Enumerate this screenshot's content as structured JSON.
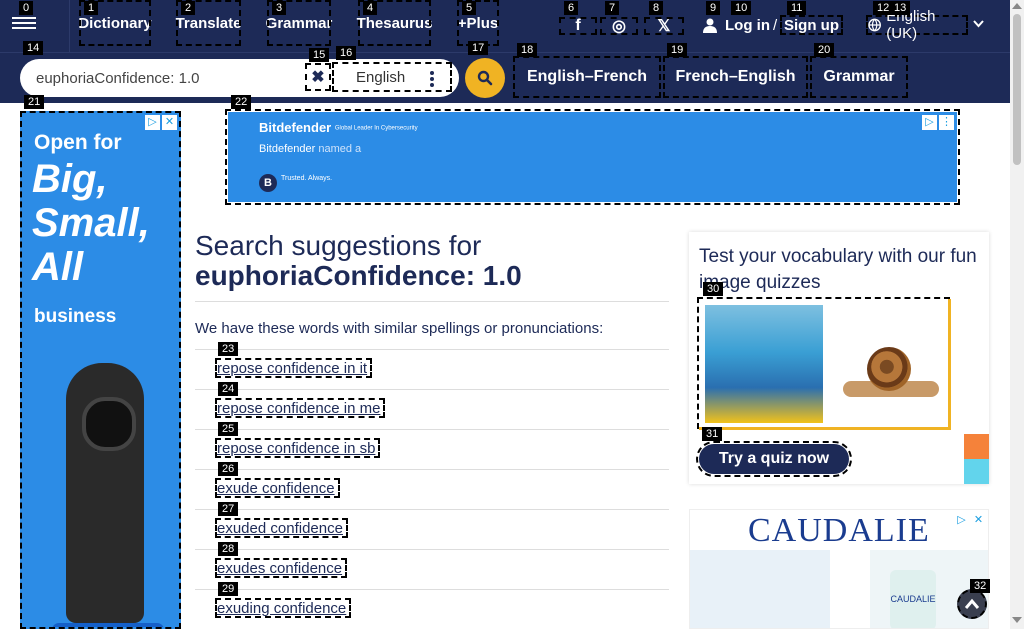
{
  "header": {
    "nav": [
      {
        "label": "Dictionary",
        "tag": "1"
      },
      {
        "label": "Translate",
        "tag": "2"
      },
      {
        "label": "Grammar",
        "tag": "3"
      },
      {
        "label": "Thesaurus",
        "tag": "4"
      },
      {
        "label": "+Plus",
        "tag": "5"
      }
    ],
    "social": [
      {
        "icon": "facebook-icon",
        "glyph": "f",
        "tag": "6"
      },
      {
        "icon": "instagram-icon",
        "glyph": "◎",
        "tag": "7"
      },
      {
        "icon": "x-icon",
        "glyph": "𝕏",
        "tag": "8"
      }
    ],
    "login_label": "Log in",
    "separator": "/",
    "signup_label": "Sign up",
    "language_label": "English (UK)",
    "tags": {
      "menu": "0",
      "user": "9",
      "login": "10",
      "signup": "11",
      "globe": "12",
      "lang": "13"
    }
  },
  "search": {
    "value": "euphoriaConfidence: 1.0",
    "language": "English",
    "tags": {
      "box": "14",
      "clear": "15",
      "lang": "16",
      "submit": "17"
    }
  },
  "directions": [
    {
      "label": "English–French",
      "tag": "18"
    },
    {
      "label": "French–English",
      "tag": "19"
    },
    {
      "label": "Grammar",
      "tag": "20"
    }
  ],
  "ads": {
    "left": {
      "tag": "21",
      "line1": "Open for",
      "line2": "Big, Small, All",
      "line3": "business"
    },
    "top": {
      "tag": "22",
      "brand": "Bitdefender",
      "brand_sub": "Global Leader In Cybersecurity",
      "text_a": "Bitdefender",
      "text_b": "named a",
      "badge": "B",
      "trust": "Trusted. Always."
    },
    "caudalie": {
      "logo": "CAUDALIE",
      "bottle_label": "CAUDALIE"
    }
  },
  "main": {
    "heading_prefix": "Search suggestions for",
    "heading_term": "euphoriaConfidence: 1.0",
    "intro": "We have these words with similar spellings or pronunciations:",
    "suggestions": [
      {
        "text": "repose confidence in it",
        "tag": "23"
      },
      {
        "text": "repose confidence in me",
        "tag": "24"
      },
      {
        "text": "repose confidence in sb",
        "tag": "25"
      },
      {
        "text": "exude confidence",
        "tag": "26"
      },
      {
        "text": "exuded confidence",
        "tag": "27"
      },
      {
        "text": "exudes confidence",
        "tag": "28"
      },
      {
        "text": "exuding confidence",
        "tag": "29"
      }
    ]
  },
  "quiz": {
    "title": "Test your vocabulary with our fun image quizzes",
    "image_tag": "30",
    "button_label": "Try a quiz now",
    "button_tag": "31"
  },
  "back_to_top_tag": "32",
  "colors": {
    "navy": "#1d2a57",
    "accent": "#f0b323",
    "ad_blue": "#2c8ce6"
  }
}
